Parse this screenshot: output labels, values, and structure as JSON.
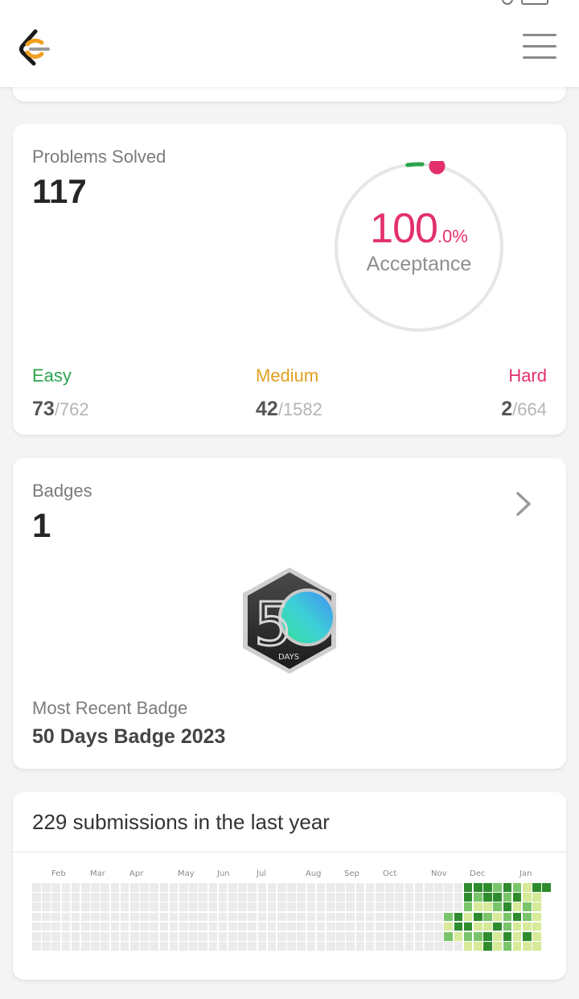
{
  "header": {
    "logo_icon": "leetcode-logo",
    "menu_icon": "hamburger-menu-icon"
  },
  "colors": {
    "easy": "#2da44e",
    "medium": "#e0a020",
    "hard": "#e3306d",
    "accent_pink": "#e3306d",
    "heat_empty": "#ebebeb",
    "heat_light": "#d6ea9a",
    "heat_mid": "#7ac46b",
    "heat_dark": "#2e8b2e"
  },
  "solved": {
    "title": "Problems Solved",
    "count": "117",
    "acceptance_value": "100",
    "acceptance_decimal": ".0%",
    "acceptance_label": "Acceptance",
    "acceptance_ratio": 1.0,
    "easy": {
      "label": "Easy",
      "solved": "73",
      "total": "/762"
    },
    "medium": {
      "label": "Medium",
      "solved": "42",
      "total": "/1582"
    },
    "hard": {
      "label": "Hard",
      "solved": "2",
      "total": "/664"
    }
  },
  "badges": {
    "title": "Badges",
    "count": "1",
    "chevron_icon": "chevron-right-icon",
    "badge_number": "5",
    "badge_caption": "DAYS",
    "recent_title": "Most Recent Badge",
    "recent_name": "50 Days Badge 2023"
  },
  "submissions": {
    "title": "229 submissions in the last year",
    "months": [
      "Feb",
      "Mar",
      "Apr",
      "May",
      "Jun",
      "Jul",
      "Aug",
      "Sep",
      "Oct",
      "Nov",
      "Dec",
      "Jan"
    ]
  }
}
